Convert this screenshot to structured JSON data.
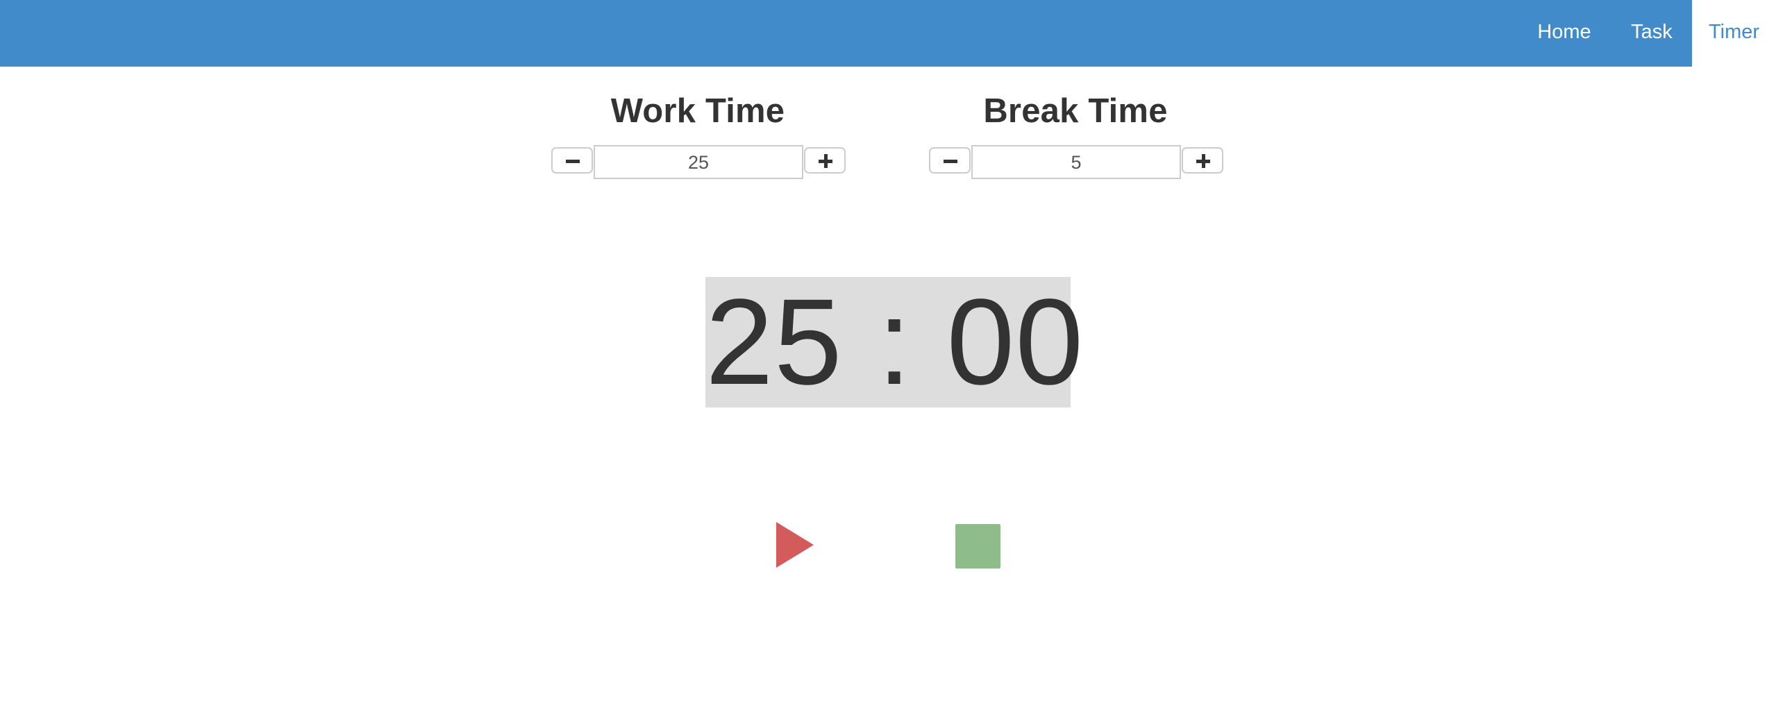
{
  "nav": {
    "items": [
      {
        "label": "Home",
        "active": false
      },
      {
        "label": "Task",
        "active": false
      },
      {
        "label": "Timer",
        "active": true
      }
    ]
  },
  "work": {
    "title": "Work Time",
    "value": "25",
    "decrement_icon": "minus-icon",
    "increment_icon": "plus-icon"
  },
  "break": {
    "title": "Break Time",
    "value": "5",
    "decrement_icon": "minus-icon",
    "increment_icon": "plus-icon"
  },
  "clock": {
    "display": "25 : 00"
  },
  "controls": {
    "play_icon": "play-icon",
    "stop_icon": "stop-icon"
  },
  "colors": {
    "navbar": "#428bca",
    "nav_active_text": "#428bca",
    "clock_background": "#dddddd",
    "play": "#d35b5b",
    "stop": "#8fbc8b"
  }
}
